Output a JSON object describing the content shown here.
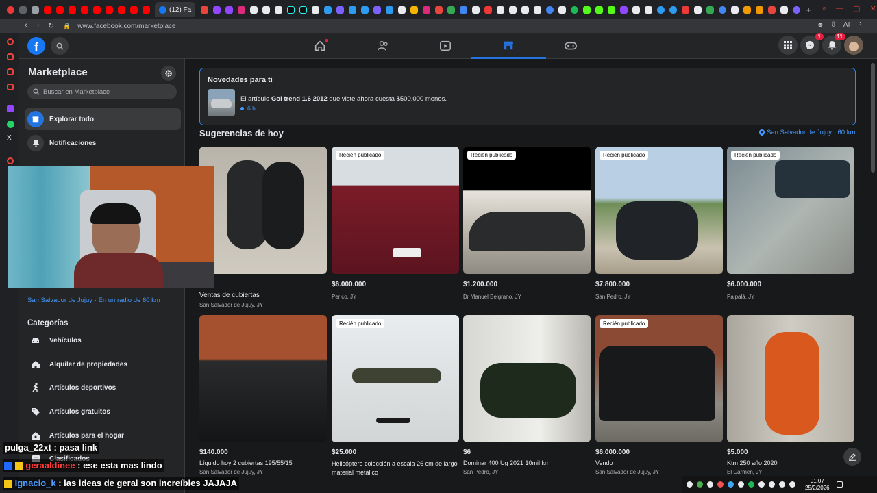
{
  "browser": {
    "active_tab_title": "(12) Fa",
    "url": "www.facebook.com/marketplace",
    "ai_label": "AI"
  },
  "nav": {
    "messenger_badge": "1",
    "notifications_badge": "11"
  },
  "sidebar": {
    "title": "Marketplace",
    "search_placeholder": "Buscar en Marketplace",
    "items": [
      {
        "label": "Explorar todo"
      },
      {
        "label": "Notificaciones"
      }
    ],
    "location_link": "San Salvador de Jujuy · En un radio de 60 km",
    "categories_heading": "Categorías",
    "categories": [
      {
        "label": "Vehículos"
      },
      {
        "label": "Alquiler de propiedades"
      },
      {
        "label": "Artículos deportivos"
      },
      {
        "label": "Artículos gratuitos"
      },
      {
        "label": "Artículos para el hogar"
      },
      {
        "label": "Clasificados"
      }
    ]
  },
  "novedades": {
    "title": "Novedades para ti",
    "prefix": "El artículo ",
    "item": "Gol trend 1.6 2012",
    "suffix": " que viste ahora cuesta $500.000 menos.",
    "time": "6 h"
  },
  "suggestions": {
    "heading": "Sugerencias de hoy",
    "location": "San Salvador de Jujuy · 60 km",
    "new_tag": "Recién publicado",
    "row1": [
      {
        "price": "",
        "title": "Ventas de cubiertas",
        "location": "San Salvador de Jujuy, JY"
      },
      {
        "price": "$6.000.000",
        "title": "",
        "location": "Perico, JY"
      },
      {
        "price": "$1.200.000",
        "title": "",
        "location": "Dr Manuel Belgrano, JY"
      },
      {
        "price": "$7.800.000",
        "title": "",
        "location": "San Pedro, JY"
      },
      {
        "price": "$6.000.000",
        "title": "",
        "location": "Palpalá, JY"
      }
    ],
    "row2": [
      {
        "price": "$140.000",
        "title": "Líquido hoy 2 cubiertas 195/55/15",
        "location": "San Salvador de Jujuy, JY"
      },
      {
        "price": "$25.000",
        "title": "Helicóptero colección a escala 26 cm de largo material metálico",
        "location": ""
      },
      {
        "price": "$6",
        "title": "Dominar 400 Ug 2021 10mil km",
        "location": "San Pedro, JY"
      },
      {
        "price": "$6.000.000",
        "title": "Vendo",
        "location": "San Salvador de Jujuy, JY"
      },
      {
        "price": "$5.000",
        "title": "Ktm 250 año 2020",
        "location": "El Carmen, JY"
      }
    ]
  },
  "stream_chat": [
    {
      "user": "pulga_22xt",
      "message": "pasa link",
      "user_color": "#ffffff"
    },
    {
      "user": "geraaldinee",
      "message": "ese esta mas lindo",
      "user_color": "#ff3b3b"
    },
    {
      "user": "Ignacio_k",
      "message": "las ideas de geral son increíbles JAJAJA",
      "user_color": "#4f9cff"
    }
  ],
  "taskbar": {
    "time": "01:07",
    "date": "25/2/2026"
  },
  "colors": {
    "fb_blue": "#1877f2",
    "accent": "#2374e1",
    "link": "#4599ff",
    "badge_red": "#e41e3f"
  }
}
